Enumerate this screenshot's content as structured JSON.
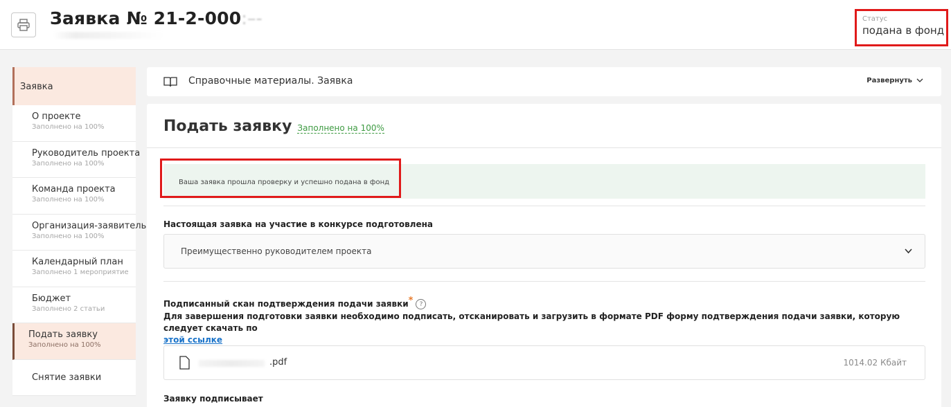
{
  "header": {
    "title": "Заявка № 21-2-000",
    "title_blurred": ":–-",
    "status_label": "Статус",
    "status_value": "подана в фонд"
  },
  "sidebar": {
    "main_label": "Заявка",
    "items": [
      {
        "label": "О проекте",
        "sub": "Заполнено на 100%"
      },
      {
        "label": "Руководитель проекта",
        "sub": "Заполнено на 100%"
      },
      {
        "label": "Команда проекта",
        "sub": "Заполнено на 100%"
      },
      {
        "label": "Организация-заявитель",
        "sub": "Заполнено на 100%"
      },
      {
        "label": "Календарный план",
        "sub": "Заполнено 1 мероприятие"
      },
      {
        "label": "Бюджет",
        "sub": "Заполнено 2 статьи"
      },
      {
        "label": "Подать заявку",
        "sub": "Заполнено на 100%"
      },
      {
        "label": "Снятие заявки",
        "sub": ""
      }
    ]
  },
  "reference": {
    "title": "Справочные материалы. Заявка",
    "expand_label": "Развернуть"
  },
  "main": {
    "title": "Подать заявку",
    "filled": "Заполнено на 100%",
    "success_message": "Ваша заявка прошла проверку и успешно подана в фонд",
    "prepared_label": "Настоящая заявка на участие в конкурсе подготовлена",
    "prepared_value": "Преимущественно руководителем проекта",
    "scan_label": "Подписанный скан подтверждения подачи заявки",
    "scan_required": "*",
    "help_glyph": "?",
    "instruction": "Для завершения подготовки заявки необходимо подписать, отсканировать и загрузить в формате PDF форму подтверждения подачи заявки, которую следует скачать по",
    "instruction_link": "этой ссылке",
    "file_name": ".pdf",
    "file_size": "1014.02 Кбайт",
    "signer_label": "Заявку подписывает"
  },
  "colors": {
    "highlight": "#e01a1a",
    "active_bg": "#fbe9e0",
    "success_bg": "#edf5ef",
    "link": "#1a73c9",
    "filled_green": "#3d9a41"
  },
  "icons": [
    "printer-icon",
    "book-icon",
    "chevron-down-icon",
    "file-icon",
    "help-icon"
  ]
}
